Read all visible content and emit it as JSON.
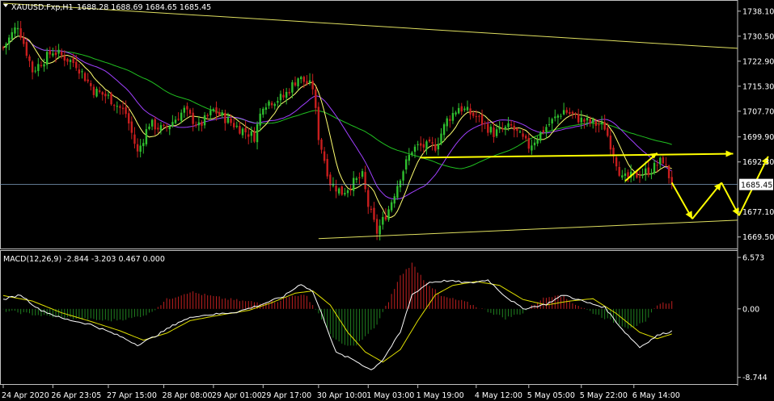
{
  "header": {
    "symbol_label": "XAUUSD.Fxp,H1",
    "ohlc_label": "1688.28 1688.69 1684.65 1685.45"
  },
  "colors": {
    "background": "#000000",
    "axis": "#c0c0c0",
    "text": "#ffffff",
    "candle_up": "#2fbf2f",
    "candle_down": "#c81e1e",
    "ma_fast": "#ffff70",
    "ma_mid": "#a040ff",
    "ma_slow": "#20c020",
    "trendline": "#e0e060",
    "annotation": "#ffff00",
    "price_line": "#7f9fbf",
    "hist_pos": "#c02020",
    "hist_neg": "#208020",
    "macd_line": "#ffffff",
    "signal_line": "#e0e000"
  },
  "chart_data": [
    {
      "type": "candlestick",
      "timeframe": "H1",
      "ylim": [
        1666.0,
        1741.0
      ],
      "y_ticks": [
        1738.1,
        1730.5,
        1722.9,
        1715.3,
        1707.7,
        1699.9,
        1692.3,
        1677.1,
        1669.5
      ],
      "current_price_label": "1685.45",
      "current_price": 1685.45,
      "x_labels": [
        "24 Apr 2020",
        "26 Apr 23:05",
        "27 Apr 15:00",
        "28 Apr 08:00",
        "29 Apr 01:00",
        "29 Apr 17:00",
        "30 Apr 10:00",
        "1 May 03:00",
        "1 May 19:00",
        "4 May 12:00",
        "5 May 05:00",
        "5 May 22:00",
        "6 May 14:00"
      ],
      "x_label_bars": [
        0,
        17,
        36,
        55,
        72,
        89,
        108,
        125,
        142,
        162,
        180,
        198,
        216
      ],
      "close_anchors": [
        [
          0,
          1727
        ],
        [
          5,
          1734
        ],
        [
          10,
          1720
        ],
        [
          17,
          1726
        ],
        [
          25,
          1722
        ],
        [
          31,
          1714
        ],
        [
          36,
          1712
        ],
        [
          42,
          1707
        ],
        [
          46,
          1695
        ],
        [
          50,
          1704
        ],
        [
          55,
          1702
        ],
        [
          62,
          1708
        ],
        [
          67,
          1703
        ],
        [
          72,
          1708
        ],
        [
          80,
          1703
        ],
        [
          86,
          1700
        ],
        [
          89,
          1710
        ],
        [
          96,
          1712
        ],
        [
          101,
          1718
        ],
        [
          106,
          1715
        ],
        [
          108,
          1700
        ],
        [
          112,
          1686
        ],
        [
          116,
          1683
        ],
        [
          120,
          1686
        ],
        [
          123,
          1688
        ],
        [
          125,
          1679
        ],
        [
          128,
          1671
        ],
        [
          132,
          1678
        ],
        [
          136,
          1688
        ],
        [
          140,
          1696
        ],
        [
          142,
          1697
        ],
        [
          148,
          1697
        ],
        [
          152,
          1705
        ],
        [
          156,
          1709
        ],
        [
          162,
          1706
        ],
        [
          168,
          1701
        ],
        [
          174,
          1703
        ],
        [
          180,
          1697
        ],
        [
          186,
          1703
        ],
        [
          192,
          1708
        ],
        [
          198,
          1705
        ],
        [
          206,
          1703
        ],
        [
          212,
          1687
        ],
        [
          216,
          1688
        ],
        [
          222,
          1690
        ],
        [
          226,
          1693
        ],
        [
          229,
          1685.5
        ]
      ],
      "channel_lines": [
        {
          "from": [
            0,
            1740.5
          ],
          "to": [
            252,
            1726.8
          ]
        },
        {
          "from": [
            108,
            1669.0
          ],
          "to": [
            252,
            1674.6
          ]
        },
        {
          "from": [
            143,
            1693.6
          ],
          "to": [
            250,
            1694.8
          ]
        }
      ],
      "projection_path": [
        [
          229,
          1686
        ],
        [
          236,
          1675
        ],
        [
          246,
          1686
        ],
        [
          252,
          1676
        ],
        [
          262,
          1694
        ]
      ]
    },
    {
      "type": "macd",
      "params_label": "MACD(12,26,9) -2.844 -3.203 0.467 0.000",
      "ylim": [
        -9.6,
        7.4
      ],
      "y_ticks": [
        6.573,
        0.0,
        -8.744
      ],
      "y_tick_labels": [
        "6.573",
        "0.00",
        "-8.744"
      ],
      "macd_anchors": [
        [
          0,
          1.2
        ],
        [
          6,
          1.8
        ],
        [
          12,
          0.0
        ],
        [
          20,
          -1.2
        ],
        [
          30,
          -2.0
        ],
        [
          40,
          -3.5
        ],
        [
          46,
          -4.6
        ],
        [
          52,
          -3.5
        ],
        [
          60,
          -1.7
        ],
        [
          66,
          -0.9
        ],
        [
          72,
          -0.7
        ],
        [
          80,
          -0.4
        ],
        [
          88,
          0.5
        ],
        [
          96,
          1.6
        ],
        [
          102,
          3.2
        ],
        [
          106,
          2.2
        ],
        [
          110,
          -1.5
        ],
        [
          114,
          -5.6
        ],
        [
          120,
          -6.5
        ],
        [
          126,
          -7.8
        ],
        [
          130,
          -6.5
        ],
        [
          136,
          -3.0
        ],
        [
          140,
          1.8
        ],
        [
          146,
          3.4
        ],
        [
          152,
          3.6
        ],
        [
          160,
          3.3
        ],
        [
          166,
          3.7
        ],
        [
          172,
          1.6
        ],
        [
          178,
          0.0
        ],
        [
          186,
          0.6
        ],
        [
          192,
          1.8
        ],
        [
          200,
          0.8
        ],
        [
          206,
          0.2
        ],
        [
          212,
          -2.6
        ],
        [
          218,
          -4.9
        ],
        [
          224,
          -3.4
        ],
        [
          229,
          -2.844
        ]
      ],
      "signal_anchors": [
        [
          0,
          1.7
        ],
        [
          10,
          1.0
        ],
        [
          20,
          -0.5
        ],
        [
          30,
          -1.6
        ],
        [
          40,
          -2.8
        ],
        [
          48,
          -4.0
        ],
        [
          56,
          -3.1
        ],
        [
          64,
          -1.5
        ],
        [
          74,
          -0.8
        ],
        [
          84,
          -0.2
        ],
        [
          92,
          0.8
        ],
        [
          100,
          2.0
        ],
        [
          106,
          2.3
        ],
        [
          112,
          0.5
        ],
        [
          118,
          -3.0
        ],
        [
          124,
          -5.5
        ],
        [
          130,
          -6.8
        ],
        [
          136,
          -5.2
        ],
        [
          142,
          -1.5
        ],
        [
          148,
          1.8
        ],
        [
          154,
          3.0
        ],
        [
          162,
          3.5
        ],
        [
          170,
          3.0
        ],
        [
          178,
          1.2
        ],
        [
          186,
          0.5
        ],
        [
          194,
          1.0
        ],
        [
          202,
          1.3
        ],
        [
          210,
          -0.6
        ],
        [
          218,
          -3.0
        ],
        [
          224,
          -3.8
        ],
        [
          229,
          -3.203
        ]
      ],
      "hist_anchors": [
        [
          0,
          -0.2
        ],
        [
          8,
          -0.6
        ],
        [
          14,
          -0.9
        ],
        [
          20,
          -1.1
        ],
        [
          28,
          -1.3
        ],
        [
          36,
          -1.5
        ],
        [
          44,
          -1.2
        ],
        [
          50,
          -0.6
        ],
        [
          56,
          1.2
        ],
        [
          64,
          2.2
        ],
        [
          70,
          1.7
        ],
        [
          76,
          1.3
        ],
        [
          82,
          1.0
        ],
        [
          88,
          0.8
        ],
        [
          94,
          1.0
        ],
        [
          100,
          1.8
        ],
        [
          104,
          1.6
        ],
        [
          108,
          -0.6
        ],
        [
          112,
          -3.2
        ],
        [
          116,
          -4.6
        ],
        [
          120,
          -4.8
        ],
        [
          124,
          -3.6
        ],
        [
          128,
          -2.0
        ],
        [
          132,
          1.0
        ],
        [
          136,
          4.2
        ],
        [
          140,
          5.8
        ],
        [
          144,
          3.8
        ],
        [
          150,
          1.6
        ],
        [
          158,
          0.9
        ],
        [
          166,
          -0.3
        ],
        [
          172,
          -1.2
        ],
        [
          178,
          -0.5
        ],
        [
          184,
          1.2
        ],
        [
          190,
          1.9
        ],
        [
          196,
          0.6
        ],
        [
          202,
          -0.5
        ],
        [
          208,
          -1.5
        ],
        [
          214,
          -2.4
        ],
        [
          220,
          -1.8
        ],
        [
          224,
          0.6
        ],
        [
          229,
          0.9
        ]
      ]
    }
  ]
}
